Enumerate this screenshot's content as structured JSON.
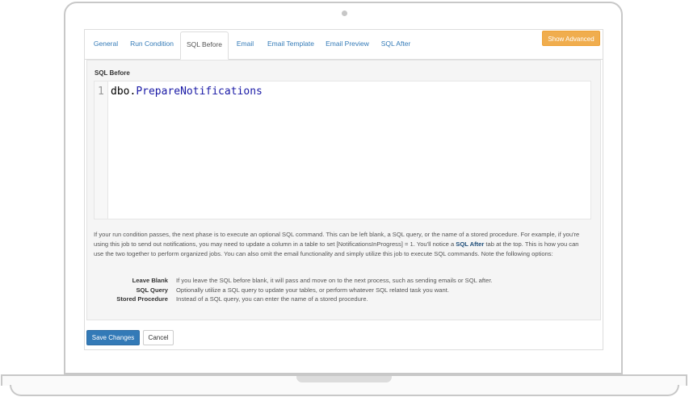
{
  "tabs": [
    {
      "label": "General"
    },
    {
      "label": "Run Condition"
    },
    {
      "label": "SQL Before"
    },
    {
      "label": "Email"
    },
    {
      "label": "Email Template"
    },
    {
      "label": "Email Preview"
    },
    {
      "label": "SQL After"
    }
  ],
  "active_tab": "SQL Before",
  "show_advanced_label": "Show Advanced",
  "section_label": "SQL Before",
  "editor": {
    "line_number": "1",
    "code_prefix": "dbo.",
    "code_object": "PrepareNotifications"
  },
  "help": {
    "text_before": "If your run condition passes, the next phase is to execute an optional SQL command. This can be left blank, a SQL query, or the name of a stored procedure. For example, if you're using this job to send out notifications, you may need to update a column in a table to set [NotificationsInProgress] = 1. You'll notice a ",
    "bold": "SQL After",
    "text_after": " tab at the top. This is how you can use the two together to perform organized jobs. You can also omit the email functionality and simply utilize this job to execute SQL commands. Note the following options:"
  },
  "options": [
    {
      "key": "Leave Blank",
      "value": "If you leave the SQL before blank, it will pass and move on to the next process, such as sending emails or SQL after."
    },
    {
      "key": "SQL Query",
      "value": "Optionally utilize a SQL query to update your tables, or perform whatever SQL related task you want."
    },
    {
      "key": "Stored Procedure",
      "value": "Instead of a SQL query, you can enter the name of a stored procedure."
    }
  ],
  "save_label": "Save Changes",
  "cancel_label": "Cancel",
  "colors": {
    "primary": "#337ab7",
    "warning": "#f0ad4e",
    "well": "#f5f5f5"
  }
}
